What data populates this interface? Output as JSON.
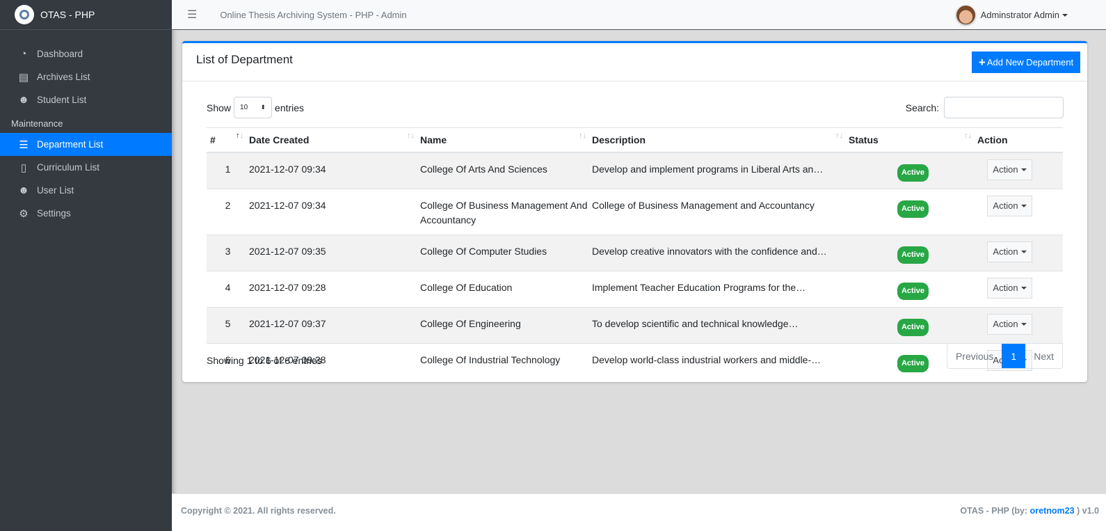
{
  "sidebar": {
    "brand": "OTAS - PHP",
    "items": [
      {
        "label": "Dashboard",
        "icon": "tachometer-icon"
      },
      {
        "label": "Archives List",
        "icon": "archive-icon"
      },
      {
        "label": "Student List",
        "icon": "users-icon"
      }
    ],
    "section": "Maintenance",
    "maint_items": [
      {
        "label": "Department List",
        "icon": "th-list-icon",
        "active": true
      },
      {
        "label": "Curriculum List",
        "icon": "scroll-icon"
      },
      {
        "label": "User List",
        "icon": "users-cog-icon"
      },
      {
        "label": "Settings",
        "icon": "cogs-icon"
      }
    ]
  },
  "topbar": {
    "title": "Online Thesis Archiving System - PHP - Admin",
    "user": "Adminstrator Admin"
  },
  "card": {
    "title": "List of Department",
    "add_label": "Add New Department",
    "show_label": "Show",
    "entries_label": "entries",
    "page_length": "10",
    "search_label": "Search:",
    "search_value": ""
  },
  "table": {
    "headers": [
      "#",
      "Date Created",
      "Name",
      "Description",
      "Status",
      "Action"
    ],
    "rows": [
      {
        "n": "1",
        "date": "2021-12-07 09:34",
        "name": "College Of Arts And Sciences",
        "desc": "Develop and implement programs in Liberal Arts an…",
        "status": "Active",
        "action": "Action"
      },
      {
        "n": "2",
        "date": "2021-12-07 09:34",
        "name": "College Of Business Management And Accountancy",
        "desc": "College of Business Management and Accountancy",
        "status": "Active",
        "action": "Action"
      },
      {
        "n": "3",
        "date": "2021-12-07 09:35",
        "name": "College Of Computer Studies",
        "desc": "Develop creative innovators with the confidence and…",
        "status": "Active",
        "action": "Action"
      },
      {
        "n": "4",
        "date": "2021-12-07 09:28",
        "name": "College Of Education",
        "desc": "Implement Teacher Education Programs for the…",
        "status": "Active",
        "action": "Action"
      },
      {
        "n": "5",
        "date": "2021-12-07 09:37",
        "name": "College Of Engineering",
        "desc": "To develop scientific and technical knowledge…",
        "status": "Active",
        "action": "Action"
      },
      {
        "n": "6",
        "date": "2021-12-07 09:28",
        "name": "College Of Industrial Technology",
        "desc": "Develop world-class industrial workers and middle-…",
        "status": "Active",
        "action": "Action"
      }
    ]
  },
  "info": "Showing 1 to 6 of 6 entries",
  "pager": {
    "prev": "Previous",
    "page": "1",
    "next": "Next"
  },
  "footer": {
    "left": "Copyright © 2021. All rights reserved.",
    "right_prefix": "OTAS - PHP (by: ",
    "author": "oretnom23",
    "right_suffix": " ) v1.0"
  },
  "colors": {
    "primary": "#007bff",
    "sidebar": "#343a40",
    "success": "#28a745"
  }
}
